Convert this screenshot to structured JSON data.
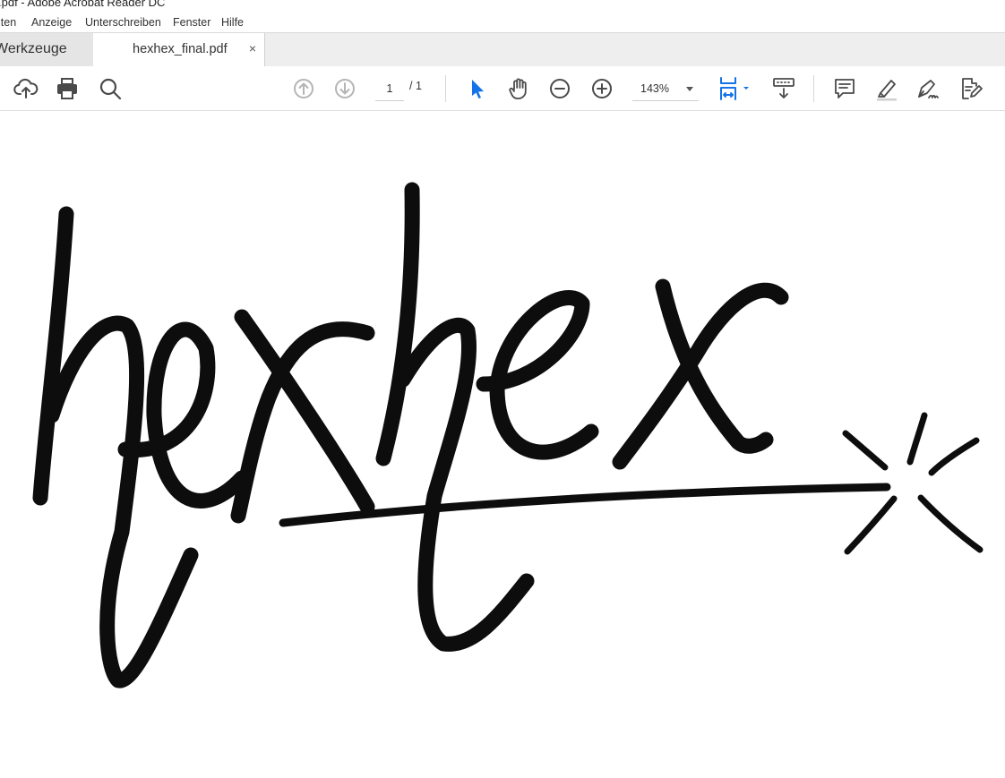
{
  "window": {
    "title": ".pdf - Adobe Acrobat Reader DC"
  },
  "menu": {
    "items": [
      "iten",
      "Anzeige",
      "Unterschreiben",
      "Fenster",
      "Hilfe"
    ]
  },
  "tabs": {
    "tools_label": "Werkzeuge",
    "document_label": "hexhex_final.pdf",
    "close_glyph": "×"
  },
  "toolbar": {
    "page_current": "1",
    "page_total": "/ 1",
    "zoom": "143%",
    "accent_color": "#1473e6",
    "icons": [
      "upload-icon",
      "print-icon",
      "search-icon",
      "page-up-icon",
      "page-down-icon",
      "select-arrow-icon",
      "hand-icon",
      "zoom-out-icon",
      "zoom-in-icon",
      "fit-page-icon",
      "scroll-mode-icon",
      "comment-icon",
      "highlight-icon",
      "sign-icon",
      "edit-pdf-icon"
    ]
  },
  "document": {
    "artwork": "hexhex",
    "ink_color": "#0d0d0d"
  }
}
